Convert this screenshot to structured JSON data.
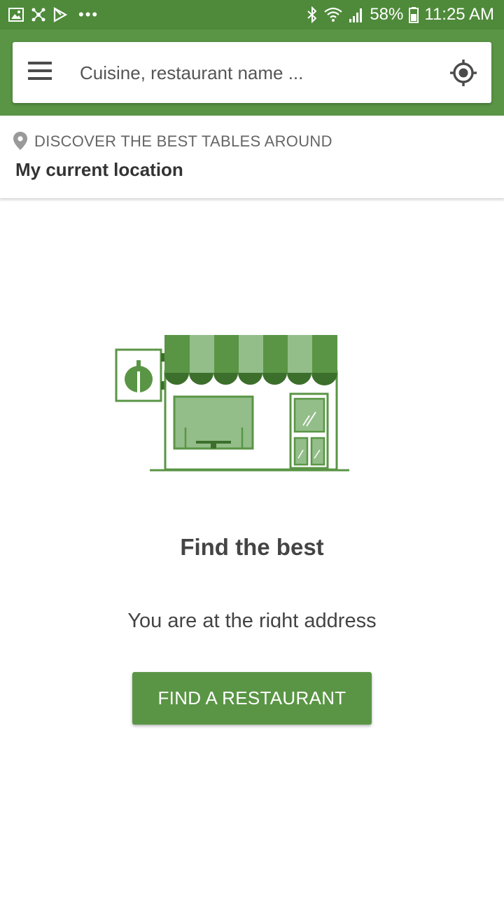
{
  "status_bar": {
    "battery": "58%",
    "time": "11:25 AM",
    "icons": [
      "image-icon",
      "network-icon",
      "play-store-icon",
      "more-notifications-icon",
      "bluetooth-icon",
      "wifi-icon",
      "signal-icon",
      "battery-icon"
    ]
  },
  "search": {
    "placeholder": "Cuisine, restaurant name ..."
  },
  "location": {
    "label": "DISCOVER THE BEST TABLES AROUND",
    "value": "My current location"
  },
  "main": {
    "headline": "Find the best",
    "subline": "You are at the right address",
    "cta_label": "FIND A RESTAURANT"
  },
  "colors": {
    "brand_green": "#5a9545",
    "status_green": "#4e8a3a",
    "light_green": "#93be8a",
    "dark_green": "#3d6f2c"
  }
}
